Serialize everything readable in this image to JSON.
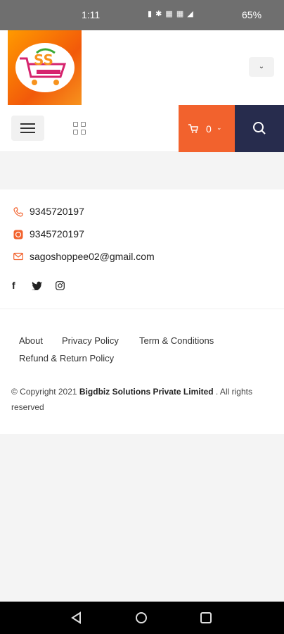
{
  "status_bar": {
    "time": "1:11",
    "icons": "▮ ✱ ▦ ▦ ◢ ",
    "battery": "65%"
  },
  "header": {
    "logo_text": "SS",
    "language_dropdown": "⌄"
  },
  "nav": {
    "cart_count": "0",
    "cart_caret": "⌄"
  },
  "contact": {
    "phone": "9345720197",
    "whatsapp": "9345720197",
    "email": "sagoshoppee02@gmail.com"
  },
  "social": {
    "facebook": "f"
  },
  "footer": {
    "links": [
      "About",
      "Privacy Policy",
      "Term & Conditions",
      "Refund & Return Policy"
    ],
    "copyright_prefix": "© Copyright 2021 ",
    "company": "Bigdbiz Solutions Private Limited",
    "copyright_suffix": " . All rights reserved"
  },
  "colors": {
    "accent_orange": "#f2622d",
    "navy": "#272c4d"
  }
}
